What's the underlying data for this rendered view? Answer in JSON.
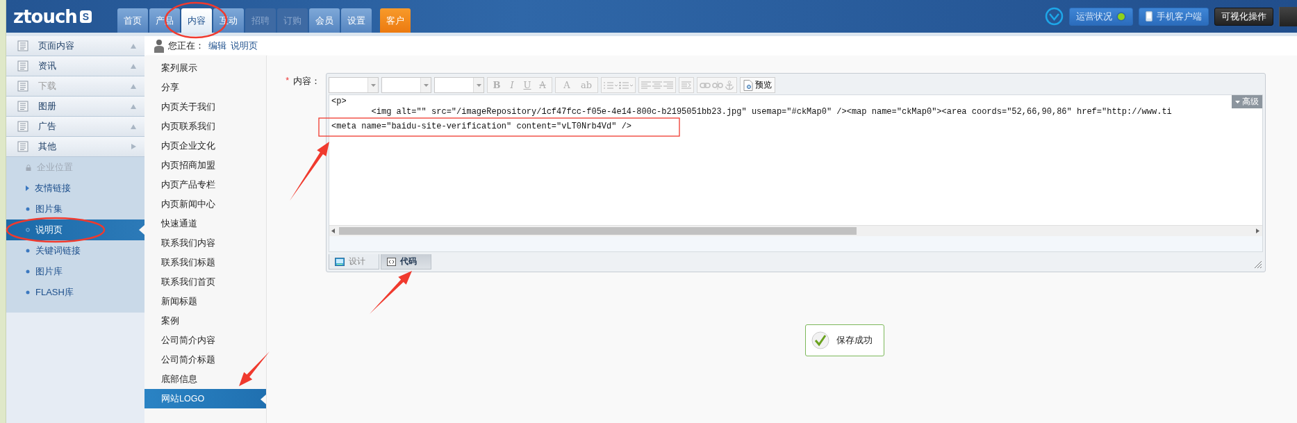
{
  "logo": {
    "text": "ztouch",
    "badge": "S"
  },
  "nav_tabs": [
    {
      "label": "首页",
      "selected": false,
      "disabled": false,
      "kind": "normal"
    },
    {
      "label": "产品",
      "selected": false,
      "disabled": false,
      "kind": "normal"
    },
    {
      "label": "内容",
      "selected": true,
      "disabled": false,
      "kind": "normal"
    },
    {
      "label": "互动",
      "selected": false,
      "disabled": false,
      "kind": "normal"
    },
    {
      "label": "招聘",
      "selected": false,
      "disabled": true,
      "kind": "normal"
    },
    {
      "label": "订购",
      "selected": false,
      "disabled": true,
      "kind": "normal"
    },
    {
      "label": "会员",
      "selected": false,
      "disabled": false,
      "kind": "normal"
    },
    {
      "label": "设置",
      "selected": false,
      "disabled": false,
      "kind": "normal"
    },
    {
      "label": "客户",
      "selected": false,
      "disabled": false,
      "kind": "accent"
    }
  ],
  "header_actions": [
    {
      "label": "运营状况",
      "kind": "status"
    },
    {
      "label": "手机客户端",
      "kind": "mobile"
    },
    {
      "label": "可视化操作",
      "kind": "dark"
    }
  ],
  "sidebar": {
    "groups": [
      {
        "label": "页面内容",
        "expanded": false,
        "disabled": false
      },
      {
        "label": "资讯",
        "expanded": false,
        "disabled": false
      },
      {
        "label": "下载",
        "expanded": false,
        "disabled": true
      },
      {
        "label": "图册",
        "expanded": false,
        "disabled": false
      },
      {
        "label": "广告",
        "expanded": false,
        "disabled": false
      },
      {
        "label": "其他",
        "expanded": true,
        "disabled": false
      }
    ],
    "items": [
      {
        "label": "企业位置",
        "kind": "locked",
        "selected": false
      },
      {
        "label": "友情链接",
        "kind": "arrow",
        "selected": false
      },
      {
        "label": "图片集",
        "kind": "bullet",
        "selected": false
      },
      {
        "label": "说明页",
        "kind": "bullet",
        "selected": true
      },
      {
        "label": "关键词链接",
        "kind": "bullet",
        "selected": false
      },
      {
        "label": "图片库",
        "kind": "bullet",
        "selected": false
      },
      {
        "label": "FLASH库",
        "kind": "bullet",
        "selected": false
      }
    ]
  },
  "breadcrumb": {
    "prefix": "您正在：",
    "links": [
      "编辑",
      "说明页"
    ]
  },
  "submenu": [
    {
      "label": "案列展示",
      "selected": false
    },
    {
      "label": "分享",
      "selected": false
    },
    {
      "label": "内页关于我们",
      "selected": false
    },
    {
      "label": "内页联系我们",
      "selected": false
    },
    {
      "label": "内页企业文化",
      "selected": false
    },
    {
      "label": "内页招商加盟",
      "selected": false
    },
    {
      "label": "内页产品专栏",
      "selected": false
    },
    {
      "label": "内页新闻中心",
      "selected": false
    },
    {
      "label": "快速通道",
      "selected": false
    },
    {
      "label": "联系我们内容",
      "selected": false
    },
    {
      "label": "联系我们标题",
      "selected": false
    },
    {
      "label": "联系我们首页",
      "selected": false
    },
    {
      "label": "新闻标题",
      "selected": false
    },
    {
      "label": "案例",
      "selected": false
    },
    {
      "label": "公司简介内容",
      "selected": false
    },
    {
      "label": "公司简介标题",
      "selected": false
    },
    {
      "label": "底部信息",
      "selected": false
    },
    {
      "label": "网站LOGO",
      "selected": true
    }
  ],
  "editor": {
    "required_mark": "*",
    "label": "内容：",
    "format_buttons": [
      "B",
      "I",
      "U",
      "A"
    ],
    "color_buttons": [
      "A",
      "ab"
    ],
    "preview_label": "预览",
    "advanced_label": "高级",
    "code_lines": [
      "<p>",
      "\t<img alt=\"\" src=\"/imageRepository/1cf47fcc-f05e-4e14-800c-b2195051bb23.jpg\" usemap=\"#ckMap0\" /><map name=\"ckMap0\"><area coords=\"52,66,90,86\" href=\"http://www.ti",
      "<meta name=\"baidu-site-verification\" content=\"vLT0Nrb4Vd\" />"
    ],
    "mode_tabs": [
      {
        "label": "设计",
        "selected": false
      },
      {
        "label": "代码",
        "selected": true
      }
    ]
  },
  "save_status": {
    "label": "保存成功"
  }
}
